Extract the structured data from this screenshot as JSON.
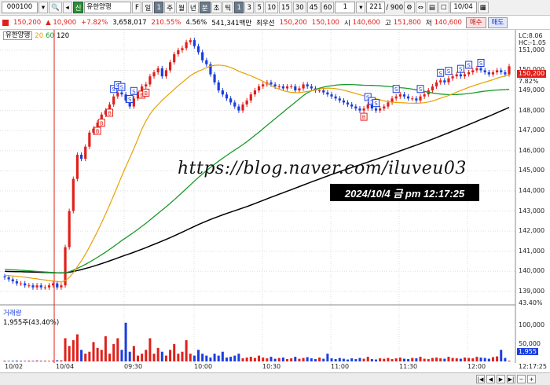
{
  "toolbar": {
    "code": "000100",
    "search_icon": "search-icon",
    "lock_icon": "lock-icon",
    "stock_badge": "신",
    "stock_name": "유한양행",
    "f_button": "F",
    "period_label": "일",
    "period_count": "1",
    "periods": [
      "주",
      "월",
      "년",
      "분",
      "초",
      "틱"
    ],
    "minute_values": [
      "1",
      "3",
      "5",
      "10",
      "15",
      "30",
      "45",
      "60"
    ],
    "interval_value": "1",
    "count_value": "221",
    "count_total": "/ 900",
    "date_value": "10/04"
  },
  "quote": {
    "price": "150,200",
    "change": "▲ 10,900",
    "change_pct": "+7.82%",
    "volume": "3,658,017",
    "vol_ratio": "210.55%",
    "turnover_ratio": "4.56%",
    "amount": "541,341백만",
    "best_ask_label": "최우선",
    "best_ask": "150,200",
    "best_bid": "150,100",
    "open_label": "시",
    "open": "140,600",
    "high_label": "고",
    "high": "151,800",
    "low_label": "저",
    "low": "140,600",
    "buy_button": "매수",
    "sell_button": "매도"
  },
  "legend": {
    "name": "유한양행",
    "ma": [
      "20",
      "60",
      "120"
    ],
    "ma_colors": [
      "#e8a000",
      "#1a9a2a",
      "#000000"
    ],
    "volume_title": "거래량",
    "volume_value": "1,955주(43.40%)"
  },
  "axis": {
    "lc": "LC:8.06",
    "hc": "HC:-1.05",
    "price_ticks": [
      "151,000",
      "150,000",
      "149,000",
      "148,000",
      "147,000",
      "146,000",
      "145,000",
      "144,000",
      "143,000",
      "142,000",
      "141,000",
      "140,000",
      "139,000"
    ],
    "current_price_tag": "150,200",
    "current_pct": "7.82%",
    "pct_low": "43.40%",
    "volume_ticks": [
      "100,000",
      "50,000"
    ],
    "volume_tag": "1,955",
    "time_label": "12:17:25",
    "time_ticks": [
      "10/02",
      "10/04",
      "09:30",
      "10:00",
      "10:30",
      "11:00",
      "11:30",
      "12:00"
    ]
  },
  "overlay": {
    "watermark": "https://blog.naver.com/iluveu03",
    "timestamp": "2024/10/4 금 pm 12:17:25"
  },
  "colors": {
    "up": "#e0201b",
    "down": "#1b3ee0",
    "ma20": "#e8a000",
    "ma60": "#1a9a2a",
    "ma120": "#000000"
  },
  "chart_data": {
    "type": "candlestick",
    "price_ylim": [
      138800,
      151700
    ],
    "closes": [
      139700,
      139600,
      139500,
      139400,
      139400,
      139300,
      139300,
      139200,
      139300,
      139200,
      139200,
      139300,
      139400,
      139200,
      139300,
      141200,
      143000,
      144600,
      145800,
      145600,
      146200,
      146900,
      147100,
      147400,
      147800,
      148000,
      148300,
      148700,
      148900,
      148800,
      148500,
      148200,
      148600,
      148800,
      149200,
      149300,
      149700,
      149900,
      150100,
      149700,
      150000,
      150400,
      150800,
      151000,
      151100,
      151400,
      151500,
      151200,
      150900,
      150500,
      150300,
      149800,
      149400,
      149000,
      148800,
      148600,
      148400,
      148200,
      148000,
      148300,
      148500,
      148800,
      149000,
      149200,
      149300,
      149400,
      149300,
      149200,
      149200,
      149100,
      149200,
      149200,
      149000,
      149100,
      149300,
      149200,
      149100,
      149000,
      149000,
      148900,
      148800,
      148700,
      148600,
      148500,
      148400,
      148300,
      148200,
      148100,
      148000,
      148100,
      148300,
      148100,
      148000,
      148100,
      148200,
      148400,
      148600,
      148700,
      148800,
      148700,
      148600,
      148600,
      148500,
      148700,
      148800,
      149000,
      149200,
      149400,
      149500,
      149400,
      149600,
      149700,
      149800,
      149700,
      149800,
      149900,
      150000,
      150100,
      150000,
      149900,
      149800,
      149900,
      150000,
      149900,
      149800,
      150200
    ],
    "volume_ylim": [
      0,
      130000
    ],
    "volumes": [
      2000,
      1500,
      1800,
      2200,
      1900,
      1500,
      2100,
      1700,
      2500,
      1800,
      2000,
      1600,
      2200,
      3000,
      2800,
      60000,
      40000,
      55000,
      70000,
      30000,
      20000,
      25000,
      50000,
      35000,
      30000,
      65000,
      20000,
      45000,
      60000,
      30000,
      100000,
      25000,
      40000,
      15000,
      20000,
      30000,
      60000,
      20000,
      35000,
      25000,
      15000,
      30000,
      45000,
      20000,
      25000,
      55000,
      20000,
      15000,
      30000,
      20000,
      15000,
      10000,
      20000,
      15000,
      25000,
      10000,
      12000,
      15000,
      20000,
      8000,
      10000,
      12000,
      9000,
      15000,
      10000,
      8000,
      12000,
      7000,
      9000,
      10000,
      6000,
      8000,
      12000,
      7000,
      9000,
      11000,
      8000,
      6000,
      10000,
      7000,
      20000,
      8000,
      6000,
      9000,
      7000,
      5000,
      8000,
      6000,
      9000,
      7000,
      12000,
      6000,
      5000,
      8000,
      7000,
      9000,
      6000,
      8000,
      10000,
      7000,
      6000,
      9000,
      8000,
      12000,
      7000,
      6000,
      9000,
      10000,
      8000,
      7000,
      12000,
      9000,
      8000,
      7000,
      10000,
      9000,
      8000,
      12000,
      10000,
      9000,
      7000,
      11000,
      13000,
      30000,
      9000,
      1955
    ]
  }
}
